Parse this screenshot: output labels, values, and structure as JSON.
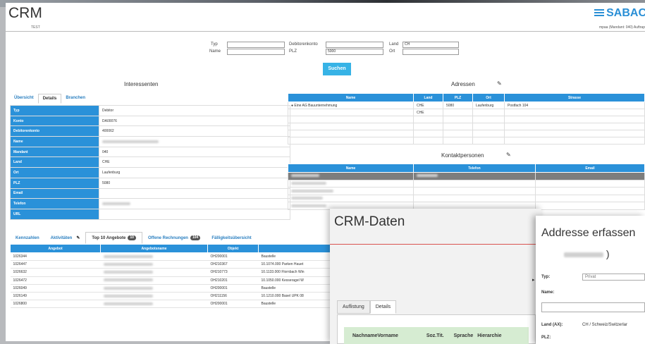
{
  "header": {
    "title": "CRM",
    "subtitle": "TEST",
    "brand": "SABAC",
    "brand_sub": "mpaa (Mandant: 040) Auftrap"
  },
  "search": {
    "typ_label": "Typ",
    "name_label": "Name",
    "debitor_label": "Debitorenkonto",
    "plz_label": "PLZ",
    "plz_value": "5000",
    "land_label": "Land",
    "land_value": "CH",
    "ort_label": "Ort",
    "button": "Suchen"
  },
  "interessenten": {
    "title": "Interessenten",
    "tabs": [
      "Übersicht",
      "Details",
      "Branchen"
    ],
    "rows": [
      {
        "k": "Typ",
        "v": "Debitor"
      },
      {
        "k": "Konto",
        "v": "DA00076"
      },
      {
        "k": "Debitorenkonto",
        "v": "400062"
      },
      {
        "k": "Name",
        "v": ""
      },
      {
        "k": "Mandant",
        "v": "040"
      },
      {
        "k": "Land",
        "v": "CHE"
      },
      {
        "k": "Ort",
        "v": "Laufenburg"
      },
      {
        "k": "PLZ",
        "v": "5080"
      },
      {
        "k": "Email",
        "v": ""
      },
      {
        "k": "Telefon",
        "v": ""
      },
      {
        "k": "URL",
        "v": ""
      }
    ]
  },
  "adressen": {
    "title": "Adressen",
    "columns": [
      "Name",
      "Land",
      "PLZ",
      "Ort",
      "Strasse"
    ],
    "rows": [
      [
        "● Eine AG Bauunternehmung",
        "CHE",
        "5080",
        "Laufenburg",
        "Postfach 104"
      ],
      [
        "",
        "CHE",
        "",
        "",
        ""
      ],
      [
        "",
        "",
        "",
        "",
        ""
      ],
      [
        "",
        "",
        "",
        "",
        ""
      ],
      [
        "",
        "",
        "",
        "",
        ""
      ],
      [
        "",
        "",
        "",
        "",
        ""
      ]
    ]
  },
  "kontakt": {
    "title": "Kontaktpersonen",
    "columns": [
      "Name",
      "Telefon",
      "Email"
    ]
  },
  "bottom_tabs": {
    "items": [
      {
        "label": "Kennzahlen"
      },
      {
        "label": "Aktivitäten"
      },
      {
        "label": "Top 10 Angebote",
        "badge": "10"
      },
      {
        "label": "Offene Rechnungen",
        "badge": "104"
      },
      {
        "label": "Fälligkeitsübersicht"
      }
    ]
  },
  "angebote": {
    "columns": [
      "Angebot",
      "Angebotsname",
      "Objekt",
      ""
    ],
    "rows": [
      [
        "1026344",
        "OH200001",
        "Baustelle"
      ],
      [
        "1026447",
        "OH210367",
        "10.1074.000 Parken Hauet"
      ],
      [
        "1026632",
        "OH210773",
        "10.1133.000 Flornbach Win"
      ],
      [
        "1026472",
        "OH210201",
        "10.1050.000 Kesseragel W"
      ],
      [
        "1026049",
        "OH200001",
        "Baustelle"
      ],
      [
        "1026149",
        "OH211156",
        "10.1210.000 Basel UPK 08"
      ],
      [
        "1026800",
        "OH200001",
        "Baustelle"
      ]
    ]
  },
  "crm_panel": {
    "title": "CRM-Daten",
    "tabs": [
      "Auflistung",
      "Details"
    ],
    "columns": [
      "Nachname",
      "Vorname",
      "Soz.Tit.",
      "Sprache",
      "Hierarchie"
    ]
  },
  "addr_panel": {
    "title": "Addresse erfassen",
    "name_suffix": ")",
    "typ_label": "Typ:",
    "typ_value": "Privat",
    "name_label": "Name:",
    "land_label": "Land (AX):",
    "land_value": "CH / Schweiz/Switzerlar",
    "plz_label": "PLZ:"
  },
  "colors": {
    "accent": "#2a91d9",
    "button": "#37b3e6",
    "brand": "#2a8fd6",
    "crm_header": "#d6ecd2"
  }
}
